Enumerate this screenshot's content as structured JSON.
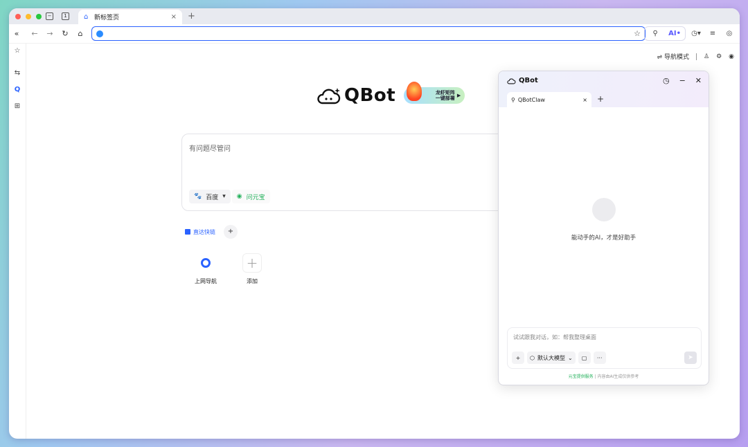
{
  "tabbar": {
    "tab_count": "1",
    "tab_title": "新标签页",
    "close_icon": "×",
    "new_tab_icon": "+"
  },
  "navbar": {
    "collapse_icon": "«",
    "back_icon": "←",
    "forward_icon": "→",
    "reload_icon": "↻",
    "home_icon": "⌂",
    "address_value": "",
    "star_icon": "☆",
    "ai_label": "AI•",
    "history_icon": "◷▾",
    "reading_icon": "≡",
    "profile_icon": "◎"
  },
  "sidebar": {
    "star_icon": "☆",
    "swap_icon": "⇆",
    "qbot_icon": "Q",
    "add_icon": "⊞"
  },
  "page_tools": {
    "nav_mode": "⇌ 导航模式",
    "shirt_icon": "♙",
    "settings_icon": "⚙",
    "eye_icon": "◉"
  },
  "logo": {
    "text": "QBot",
    "promo_line1": "龙虾矩阵",
    "promo_line2": "一键部署",
    "promo_play": "▶"
  },
  "search": {
    "placeholder": "有问题尽管问",
    "engine_baidu": "百度",
    "engine_caret": "▾",
    "engine_yuanbao": "问元宝",
    "baidu_icon": "🐾",
    "yuanbao_icon": "◉"
  },
  "quicklinks": {
    "label": "直达快链",
    "add_label": "+",
    "tiles": [
      {
        "label": "上网导航"
      },
      {
        "label": "添加",
        "icon": "+"
      }
    ]
  },
  "qbot": {
    "title": "QBot",
    "history_icon": "◷",
    "minimize_icon": "−",
    "close_icon": "✕",
    "tab_title": "QBotClaw",
    "tab_close": "×",
    "tab_add": "+",
    "tagline": "能动手的AI，才是好助手",
    "input_placeholder": "试试跟我对话，如：帮我整理桌面",
    "tool_add": "+",
    "model_label": "默认大模型",
    "model_caret": "⌄",
    "tool_clipboard": "▢",
    "tool_more": "···",
    "send_icon": "➤",
    "footer_service": "元宝提供服务",
    "footer_note": "| 内容由AI生成仅供参考"
  }
}
